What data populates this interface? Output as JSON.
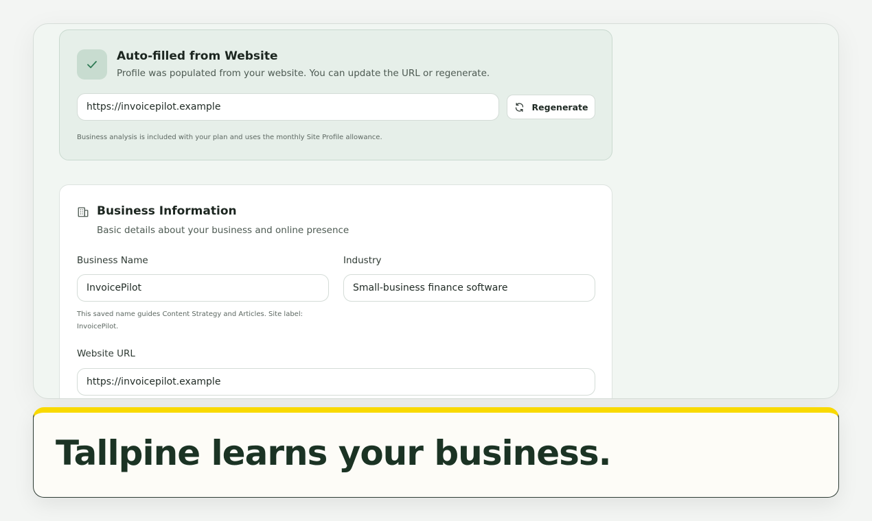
{
  "autofill": {
    "title": "Auto-filled from Website",
    "subtitle": "Profile was populated from your website. You can update the URL or regenerate.",
    "url_value": "https://invoicepilot.example",
    "regenerate_label": "Regenerate",
    "note": "Business analysis is included with your plan and uses the monthly Site Profile allowance."
  },
  "business_info": {
    "title": "Business Information",
    "subtitle": "Basic details about your business and online presence",
    "business_name_label": "Business Name",
    "business_name_value": "InvoicePilot",
    "business_name_help": "This saved name guides Content Strategy and Articles. Site label: InvoicePilot.",
    "industry_label": "Industry",
    "industry_value": "Small-business finance software",
    "website_url_label": "Website URL",
    "website_url_value": "https://invoicepilot.example"
  },
  "caption": {
    "text": "Tallpine learns your business."
  },
  "colors": {
    "accent_green": "#2f7a55",
    "banner_yellow": "#f9d900",
    "caption_dark": "#1b3324"
  },
  "icons": {
    "check": "check-icon",
    "refresh": "refresh-icon",
    "building": "building-icon"
  }
}
